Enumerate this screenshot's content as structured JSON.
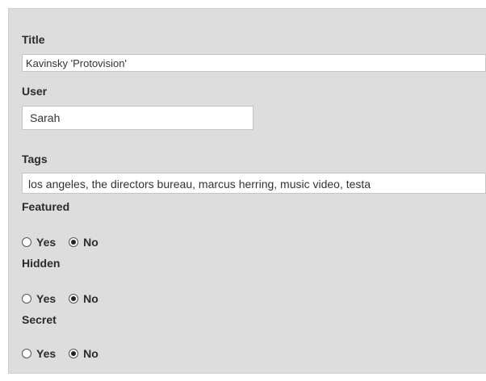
{
  "form": {
    "title": {
      "label": "Title",
      "value": "Kavinsky 'Protovision'"
    },
    "user": {
      "label": "User",
      "value": "Sarah"
    },
    "tags": {
      "label": "Tags",
      "value": "los angeles, the directors bureau, marcus herring, music video, testa"
    },
    "featured": {
      "label": "Featured",
      "yes_label": "Yes",
      "no_label": "No",
      "selected": "No"
    },
    "hidden": {
      "label": "Hidden",
      "yes_label": "Yes",
      "no_label": "No",
      "selected": "No"
    },
    "secret": {
      "label": "Secret",
      "yes_label": "Yes",
      "no_label": "No",
      "selected": "No"
    }
  }
}
